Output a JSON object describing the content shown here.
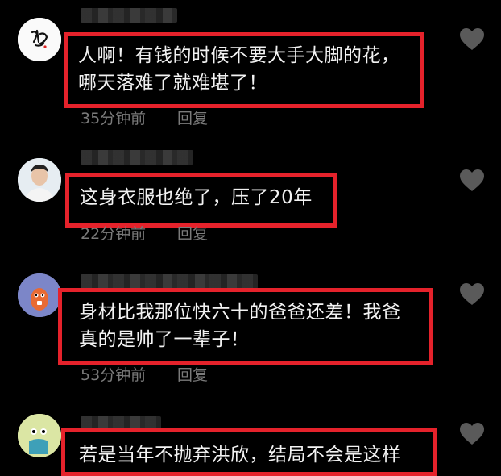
{
  "comments": [
    {
      "text": "人啊！有钱的时候不要大手大脚的花，\n哪天落难了就难堪了！",
      "time": "35分钟前",
      "reply": "回复"
    },
    {
      "text": "这身衣服也绝了，压了20年",
      "time": "22分钟前",
      "reply": "回复"
    },
    {
      "text": "身材比我那位快六十的爸爸还差！我爸\n真的是帅了一辈子！",
      "time": "53分钟前",
      "reply": "回复"
    },
    {
      "text": "若是当年不抛弃洪欣，结局不会是这样",
      "time": "",
      "reply": ""
    }
  ],
  "colors": {
    "background": "#000000",
    "highlight_box": "#e5222b",
    "meta_text": "#7a7a7a",
    "heart": "#5a5a5a"
  },
  "icons": {
    "like": "heart-icon"
  }
}
